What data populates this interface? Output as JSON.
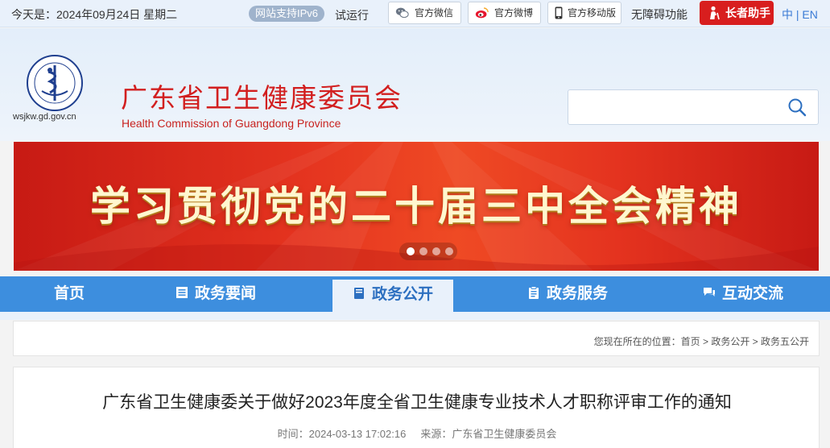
{
  "topbar": {
    "date": "今天是：2024年09月24日 星期二",
    "ipv6": "网站支持IPv6",
    "trial": "试运行",
    "wechat": "官方微信",
    "weibo": "官方微博",
    "mobile": "官方移动版",
    "accessibility": "无障碍功能",
    "elder": "长者助手",
    "lang_cn": "中",
    "lang_sep": " | ",
    "lang_en": "EN"
  },
  "header": {
    "domain": "wsjkw.gd.gov.cn",
    "title_cn": "广东省卫生健康委员会",
    "title_en": "Health Commission of Guangdong Province",
    "search_placeholder": ""
  },
  "banner": {
    "slogan": "学习贯彻党的二十届三中全会精神",
    "slide_count": 4,
    "active_slide": 1
  },
  "nav": {
    "items": [
      {
        "label": "首页",
        "icon": "home"
      },
      {
        "label": "政务要闻",
        "icon": "news-list-icon"
      },
      {
        "label": "政务公开",
        "icon": "book-icon",
        "active": true
      },
      {
        "label": "政务服务",
        "icon": "clipboard-icon"
      },
      {
        "label": "互动交流",
        "icon": "chat-icon"
      }
    ]
  },
  "breadcrumb": {
    "prefix": "您现在所在的位置：",
    "path": "首页 > 政务公开 > 政务五公开"
  },
  "article": {
    "title": "广东省卫生健康委关于做好2023年度全省卫生健康专业技术人才职称评审工作的通知",
    "time_label": "时间：",
    "time": "2024-03-13 17:02:16",
    "source_label": "来源：",
    "source": "广东省卫生健康委员会"
  },
  "colors": {
    "nav_blue": "#3d8ede",
    "brand_red": "#d21f1f",
    "elder_red": "#d81e1e",
    "banner_red": "#e4331f"
  }
}
